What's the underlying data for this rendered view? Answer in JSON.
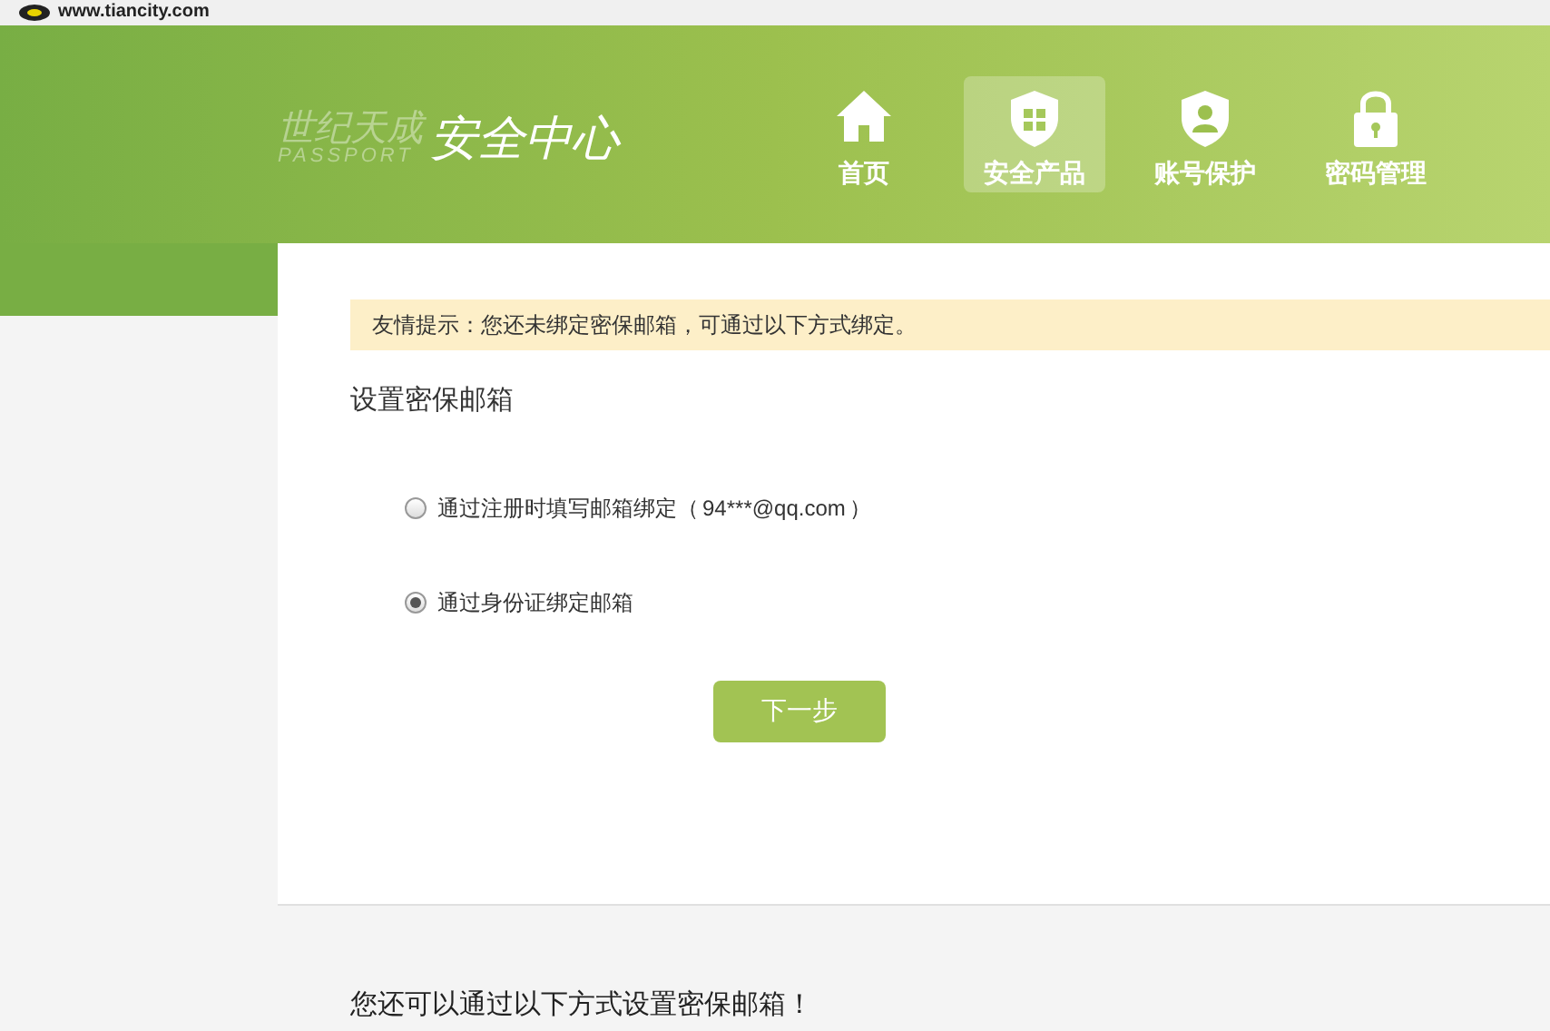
{
  "top_bar": {
    "site": "www.tiancity.com"
  },
  "header": {
    "logo_brand": "世纪天成",
    "logo_sub": "PASSPORT",
    "title": "安全中心",
    "nav": [
      {
        "label": "首页",
        "kind": "home",
        "selected": false
      },
      {
        "label": "安全产品",
        "kind": "gift",
        "selected": true
      },
      {
        "label": "账号保护",
        "kind": "user",
        "selected": false
      },
      {
        "label": "密码管理",
        "kind": "lock",
        "selected": false
      }
    ]
  },
  "notice": "友情提示：您还未绑定密保邮箱，可通过以下方式绑定。",
  "heading": "设置密保邮箱",
  "options": [
    {
      "label": "通过注册时填写邮箱绑定（",
      "email": "94***@qq.com",
      "suffix": "）",
      "selected": false
    },
    {
      "label": "通过身份证绑定邮箱",
      "selected": true
    }
  ],
  "next_button": "下一步",
  "footer_text": "您还可以通过以下方式设置密保邮箱！"
}
